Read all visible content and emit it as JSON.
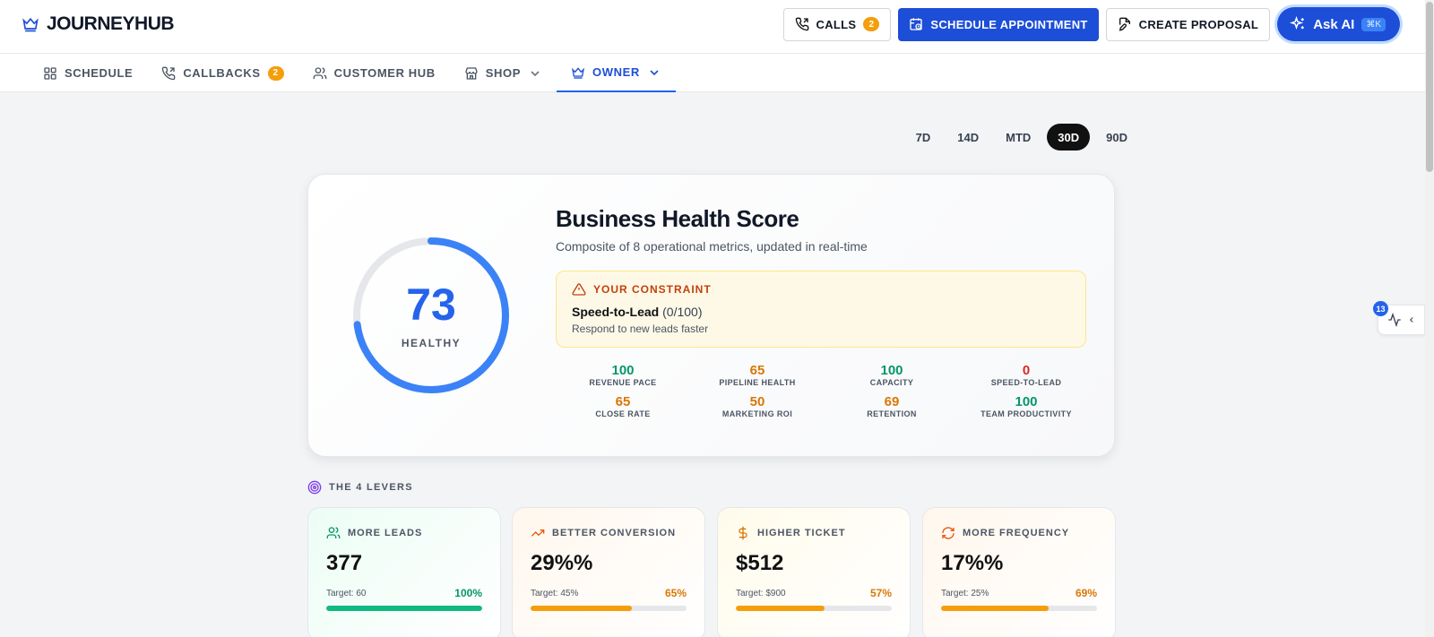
{
  "app": {
    "name": "JOURNEYHUB"
  },
  "header": {
    "calls_label": "CALLS",
    "calls_badge": "2",
    "schedule_label": "SCHEDULE APPOINTMENT",
    "proposal_label": "CREATE PROPOSAL",
    "ai_label": "Ask AI",
    "ai_shortcut": "⌘K"
  },
  "nav": {
    "schedule": "SCHEDULE",
    "callbacks": "CALLBACKS",
    "callbacks_badge": "2",
    "customer_hub": "CUSTOMER HUB",
    "shop": "SHOP",
    "owner": "OWNER"
  },
  "range": {
    "options": [
      "7D",
      "14D",
      "MTD",
      "30D",
      "90D"
    ],
    "selected": "30D"
  },
  "health": {
    "score": "73",
    "score_fraction": 0.73,
    "status": "HEALTHY",
    "title": "Business Health Score",
    "subtitle": "Composite of 8 operational metrics, updated in real-time",
    "constraint": {
      "heading": "YOUR CONSTRAINT",
      "metric": "Speed-to-Lead",
      "score": "(0/100)",
      "description": "Respond to new leads faster"
    },
    "metrics": [
      {
        "value": "100",
        "label": "REVENUE PACE",
        "color": "#059669"
      },
      {
        "value": "65",
        "label": "PIPELINE HEALTH",
        "color": "#d97706"
      },
      {
        "value": "100",
        "label": "CAPACITY",
        "color": "#059669"
      },
      {
        "value": "0",
        "label": "SPEED-TO-LEAD",
        "color": "#dc2626"
      },
      {
        "value": "65",
        "label": "CLOSE RATE",
        "color": "#d97706"
      },
      {
        "value": "50",
        "label": "MARKETING ROI",
        "color": "#d97706"
      },
      {
        "value": "69",
        "label": "RETENTION",
        "color": "#d97706"
      },
      {
        "value": "100",
        "label": "TEAM PRODUCTIVITY",
        "color": "#059669"
      }
    ]
  },
  "levers": {
    "title": "THE 4 LEVERS",
    "items": [
      {
        "title": "MORE LEADS",
        "value": "377",
        "target": "Target: 60",
        "pct": "100%",
        "progress": 1.0,
        "color": "#10b981",
        "pct_color": "#059669",
        "icon": "users-icon"
      },
      {
        "title": "BETTER CONVERSION",
        "value": "29%%",
        "target": "Target: 45%",
        "pct": "65%",
        "progress": 0.65,
        "color": "#f59e0b",
        "pct_color": "#d97706",
        "icon": "trending-up-icon"
      },
      {
        "title": "HIGHER TICKET",
        "value": "$512",
        "target": "Target: $900",
        "pct": "57%",
        "progress": 0.57,
        "color": "#f59e0b",
        "pct_color": "#d97706",
        "icon": "dollar-icon"
      },
      {
        "title": "MORE FREQUENCY",
        "value": "17%%",
        "target": "Target: 25%",
        "pct": "69%",
        "progress": 0.69,
        "color": "#f59e0b",
        "pct_color": "#d97706",
        "icon": "refresh-icon"
      }
    ]
  },
  "side_panel": {
    "badge": "13"
  },
  "colors": {
    "brand": "#1d4ed8",
    "gauge": "#3b82f6"
  }
}
